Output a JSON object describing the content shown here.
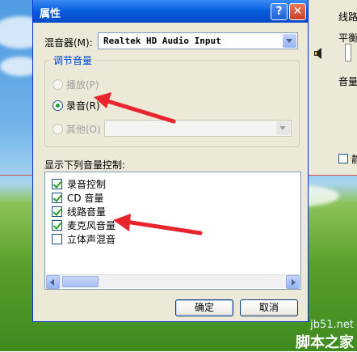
{
  "dialog": {
    "title": "属性",
    "help_btn": "?",
    "close_btn": "✕",
    "mixer_label": "混音器(M):",
    "mixer_value": "Realtek HD Audio Input",
    "group_title": "调节音量",
    "radios": [
      {
        "label": "播放(P)",
        "checked": false,
        "disabled": true
      },
      {
        "label": "录音(R)",
        "checked": true,
        "disabled": false
      },
      {
        "label": "其他(O)",
        "checked": false,
        "disabled": true
      }
    ],
    "list_label": "显示下列音量控制:",
    "list_items": [
      {
        "label": "录音控制",
        "checked": true
      },
      {
        "label": "CD 音量",
        "checked": true
      },
      {
        "label": "线路音量",
        "checked": true
      },
      {
        "label": "麦克风音量",
        "checked": true
      },
      {
        "label": "立体声混音",
        "checked": false
      }
    ],
    "ok_label": "确定",
    "cancel_label": "取消"
  },
  "background_window": {
    "col1_label": "线路",
    "col2_label": "平衡",
    "col3_label": "音量",
    "checkbox_label": "静"
  },
  "watermark": {
    "line1": "jb51.net",
    "line2": "脚本之家"
  },
  "colors": {
    "accent_red": "#e8242c",
    "title_blue": "#0a5fe0",
    "group_title_blue": "#0046d5",
    "check_green": "#21a121"
  }
}
